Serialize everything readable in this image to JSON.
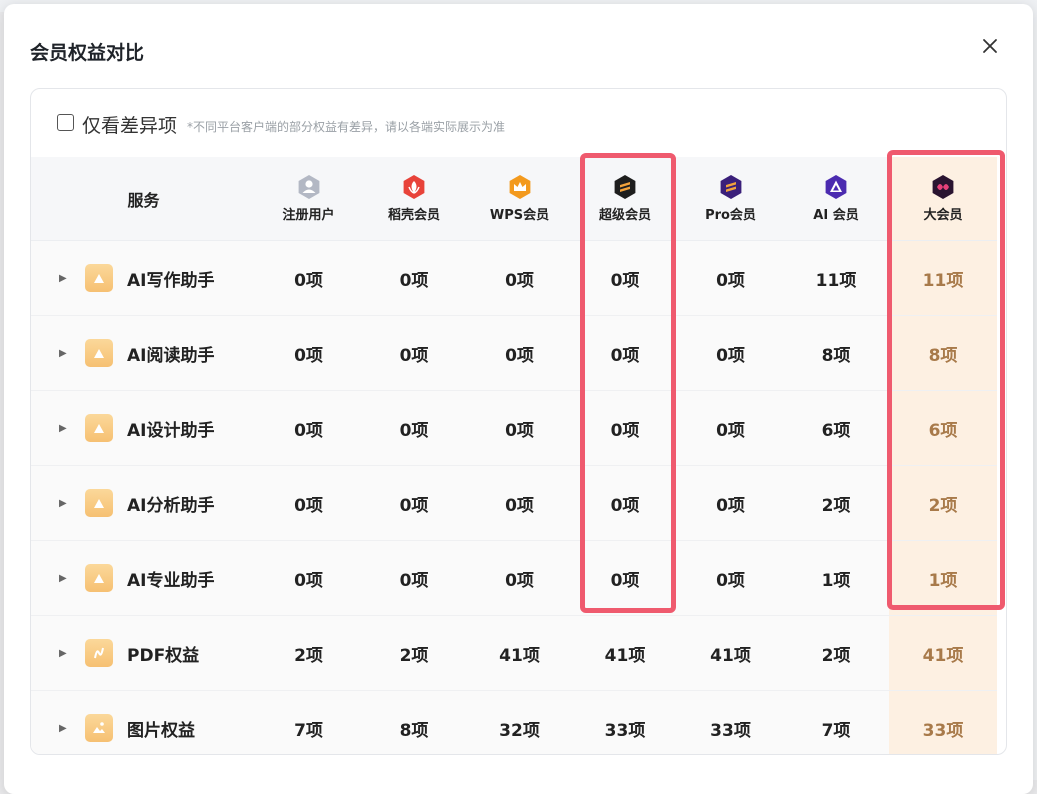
{
  "dialog": {
    "title": "会员权益对比",
    "filter_label": "仅看差异项",
    "filter_note": "*不同平台客户端的部分权益有差异，请以各端实际展示为准"
  },
  "table": {
    "service_header": "服务",
    "tiers": [
      {
        "label": "注册用户",
        "icon": "user-icon"
      },
      {
        "label": "稻壳会员",
        "icon": "docer-leaf-icon"
      },
      {
        "label": "WPS会员",
        "icon": "crown-icon"
      },
      {
        "label": "超级会员",
        "icon": "super-member-icon"
      },
      {
        "label": "Pro会员",
        "icon": "pro-member-icon"
      },
      {
        "label": "AI 会员",
        "icon": "ai-member-icon"
      },
      {
        "label": "大会员",
        "icon": "big-member-icon"
      }
    ],
    "rows": [
      {
        "name": "AI写作助手",
        "values": [
          "0项",
          "0项",
          "0项",
          "0项",
          "0项",
          "11项",
          "11项"
        ]
      },
      {
        "name": "AI阅读助手",
        "values": [
          "0项",
          "0项",
          "0项",
          "0项",
          "0项",
          "8项",
          "8项"
        ]
      },
      {
        "name": "AI设计助手",
        "values": [
          "0项",
          "0项",
          "0项",
          "0项",
          "0项",
          "6项",
          "6项"
        ]
      },
      {
        "name": "AI分析助手",
        "values": [
          "0项",
          "0项",
          "0项",
          "0项",
          "0项",
          "2项",
          "2项"
        ]
      },
      {
        "name": "AI专业助手",
        "values": [
          "0项",
          "0项",
          "0项",
          "0项",
          "0项",
          "1项",
          "1项"
        ]
      },
      {
        "name": "PDF权益",
        "values": [
          "2项",
          "2项",
          "41项",
          "41项",
          "41项",
          "2项",
          "41项"
        ]
      },
      {
        "name": "图片权益",
        "values": [
          "7项",
          "8项",
          "32项",
          "33项",
          "33项",
          "7项",
          "33项"
        ]
      }
    ]
  },
  "colors": {
    "highlight": "#ef5a6e",
    "big_member_bg": "#fdf0e2",
    "big_member_text": "#a87a4a"
  }
}
